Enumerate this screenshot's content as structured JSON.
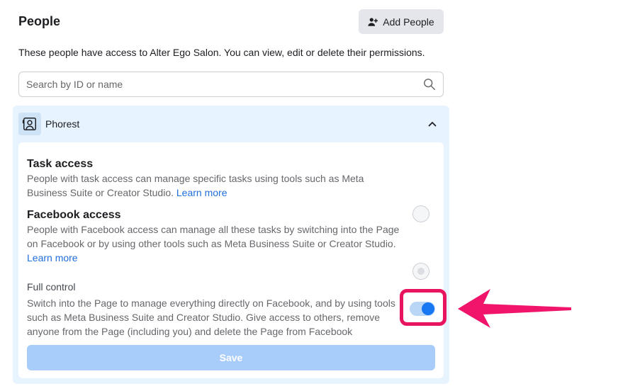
{
  "header": {
    "title": "People",
    "add_button_label": "Add People",
    "description": "These people have access to Alter Ego Salon. You can view, edit or delete their permissions."
  },
  "search": {
    "placeholder": "Search by ID or name",
    "value": ""
  },
  "person": {
    "name": "Phorest",
    "expanded": true,
    "options": [
      {
        "title": "Task access",
        "text": "People with task access can manage specific tasks using tools such as Meta Business Suite or Creator Studio.",
        "link": "Learn more",
        "selected": false
      },
      {
        "title": "Facebook access",
        "text": "People with Facebook access can manage all these tasks by switching into the Page on Facebook or by using other tools such as Meta Business Suite or Creator Studio.",
        "link": "Learn more",
        "selected": false
      }
    ],
    "full_control": {
      "title": "Full control",
      "text": "Switch into the Page to manage everything directly on Facebook, and by using tools such as Meta Business Suite and Creator Studio. Give access to others, remove anyone from the Page (including you) and delete the Page from Facebook",
      "enabled": true
    },
    "save_label": "Save"
  },
  "colors": {
    "accent": "#1877f2",
    "highlight": "#e8145f",
    "panel_bg": "#e7f3ff",
    "link": "#216fdb"
  }
}
